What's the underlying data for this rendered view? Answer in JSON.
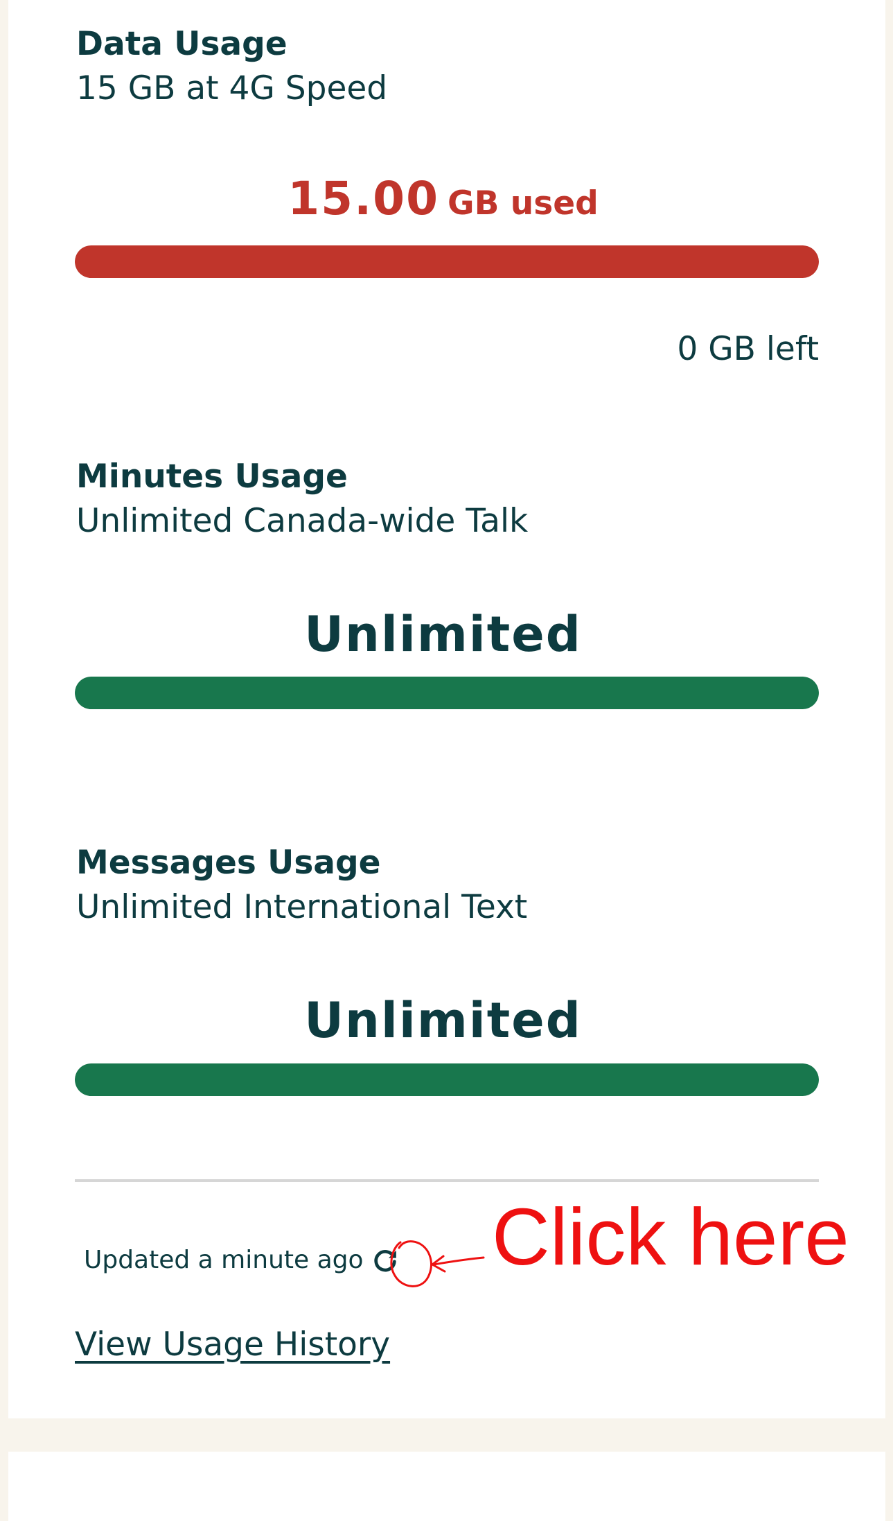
{
  "data_usage": {
    "title": "Data Usage",
    "plan": "15 GB at 4G Speed",
    "used_value": "15.00",
    "used_label": "GB used",
    "remaining": "0 GB left",
    "used_fraction": 1.0,
    "bar_color": "#c0352b"
  },
  "minutes_usage": {
    "title": "Minutes Usage",
    "plan": "Unlimited Canada-wide Talk",
    "status": "Unlimited",
    "fill_fraction": 1.0,
    "bar_color": "#18774d"
  },
  "messages_usage": {
    "title": "Messages Usage",
    "plan": "Unlimited International Text",
    "status": "Unlimited",
    "fill_fraction": 1.0,
    "bar_color": "#18774d"
  },
  "footer": {
    "updated_text": "Updated a minute ago",
    "refresh_icon": "refresh-icon",
    "history_link": "View Usage History"
  },
  "annotation": {
    "text": "Click here",
    "color": "#ee1111"
  },
  "colors": {
    "text": "#0d3b40",
    "page_background": "#f8f4ec",
    "card_background": "#ffffff"
  }
}
